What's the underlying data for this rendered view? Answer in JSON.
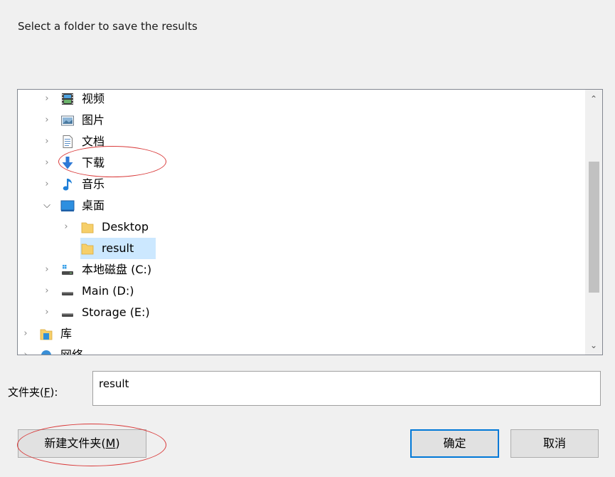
{
  "dialog": {
    "prompt": "Select a folder to save the results"
  },
  "tree": {
    "items": [
      {
        "label": "视频",
        "icon": "videos-icon",
        "expanded": false
      },
      {
        "label": "图片",
        "icon": "pictures-icon",
        "expanded": false
      },
      {
        "label": "文档",
        "icon": "documents-icon",
        "expanded": false
      },
      {
        "label": "下载",
        "icon": "downloads-icon",
        "expanded": false
      },
      {
        "label": "音乐",
        "icon": "music-icon",
        "expanded": false
      },
      {
        "label": "桌面",
        "icon": "desktop-icon",
        "expanded": true
      },
      {
        "label": "Desktop",
        "icon": "folder-icon",
        "expanded": false
      },
      {
        "label": "result",
        "icon": "folder-icon",
        "selected": true
      },
      {
        "label": "本地磁盘 (C:)",
        "icon": "system-drive-icon",
        "expanded": false
      },
      {
        "label": "Main (D:)",
        "icon": "drive-icon",
        "expanded": false
      },
      {
        "label": "Storage (E:)",
        "icon": "drive-icon",
        "expanded": false
      },
      {
        "label": "库",
        "icon": "library-icon",
        "expanded": false
      },
      {
        "label": "网络",
        "icon": "network-icon",
        "expanded": false
      }
    ]
  },
  "folder_field": {
    "label": "文件夹(",
    "accel": "F",
    "label_end": "):",
    "value": "result"
  },
  "buttons": {
    "new_folder": "新建文件夹(",
    "new_folder_accel": "M",
    "new_folder_end": ")",
    "ok": "确定",
    "cancel": "取消"
  },
  "colors": {
    "selection": "#cce8ff",
    "annotation": "#d93a3a",
    "default_button_border": "#0078d7"
  }
}
